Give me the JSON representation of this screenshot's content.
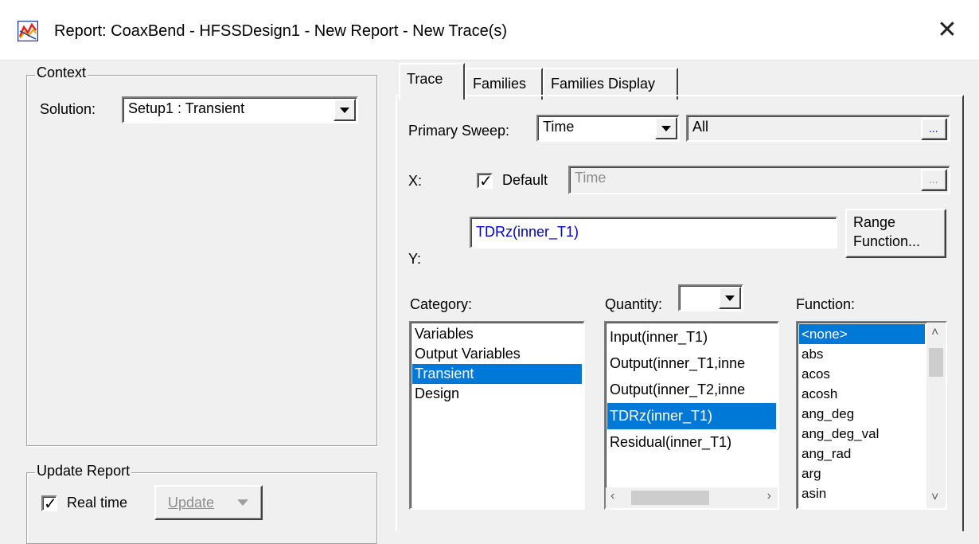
{
  "window": {
    "title": "Report: CoaxBend - HFSSDesign1 - New Report - New Trace(s)",
    "close_glyph": "✕",
    "app_icon": "report-icon"
  },
  "context": {
    "group_label": "Context",
    "solution_label": "Solution:",
    "solution_value": "Setup1 : Transient"
  },
  "update_report": {
    "group_label": "Update Report",
    "realtime_label": "Real time",
    "realtime_checked": true,
    "update_button_label": "Update"
  },
  "tabs": [
    {
      "label": "Trace",
      "active": true
    },
    {
      "label": "Families",
      "active": false
    },
    {
      "label": "Families Display",
      "active": false
    }
  ],
  "trace": {
    "primary_sweep_label": "Primary Sweep:",
    "primary_sweep_value": "Time",
    "sweep_range_value": "All",
    "ellipsis": "...",
    "x_label": "X:",
    "x_default_label": "Default",
    "x_default_checked": true,
    "x_value": "Time",
    "y_label": "Y:",
    "y_value": "TDRz(inner_T1)",
    "range_function_button": {
      "line1": "Range",
      "line2": "Function..."
    }
  },
  "category": {
    "label": "Category:",
    "items": [
      "Variables",
      "Output Variables",
      "Transient",
      "Design"
    ],
    "selected": "Transient"
  },
  "quantity": {
    "label": "Quantity:",
    "filter_value": "",
    "items": [
      "Input(inner_T1)",
      "Output(inner_T1,inne",
      "Output(inner_T2,inne",
      "TDRz(inner_T1)",
      "Residual(inner_T1)"
    ],
    "selected": "TDRz(inner_T1)"
  },
  "function": {
    "label": "Function:",
    "items": [
      "<none>",
      "abs",
      "acos",
      "acosh",
      "ang_deg",
      "ang_deg_val",
      "ang_rad",
      "arg",
      "asin"
    ],
    "selected": "<none>"
  },
  "colors": {
    "selection": "#0078d7",
    "y_expression_text": "#0000cc",
    "dialog_background": "#f0f0f0"
  }
}
